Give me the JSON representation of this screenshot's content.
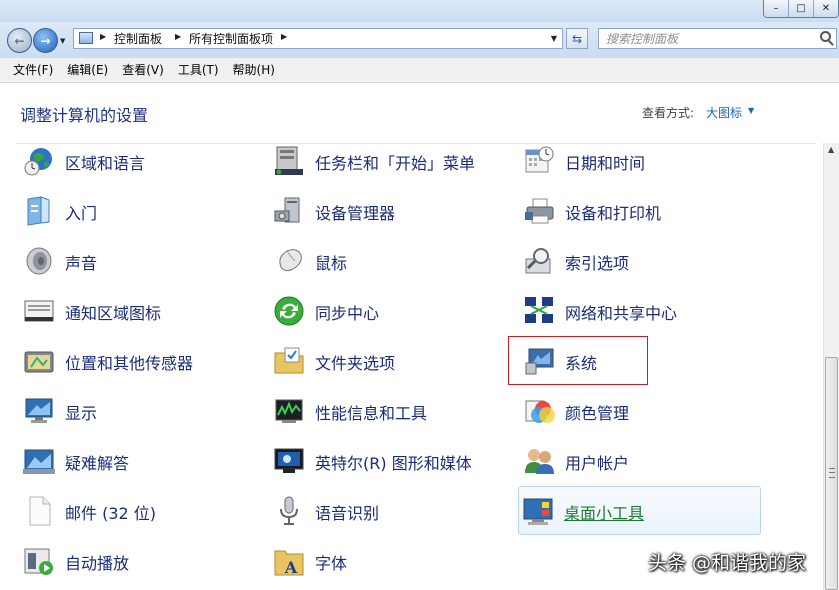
{
  "window": {
    "controls": {
      "minimize": "–",
      "maximize": "□",
      "close": "✕"
    }
  },
  "navigation": {
    "breadcrumb": [
      "控制面板",
      "所有控制面板项"
    ],
    "search_placeholder": "搜索控制面板",
    "icons": [
      "back-icon",
      "forward-icon",
      "refresh-icon",
      "search-icon"
    ]
  },
  "menubar": [
    "文件(F)",
    "编辑(E)",
    "查看(V)",
    "工具(T)",
    "帮助(H)"
  ],
  "header": {
    "title": "调整计算机的设置",
    "view_label": "查看方式:",
    "view_value": "大图标"
  },
  "items": [
    {
      "label": "区域和语言",
      "icon": "globe-clock-icon"
    },
    {
      "label": "任务栏和「开始」菜单",
      "icon": "taskbar-icon"
    },
    {
      "label": "日期和时间",
      "icon": "calendar-clock-icon"
    },
    {
      "label": "入门",
      "icon": "getting-started-icon"
    },
    {
      "label": "设备管理器",
      "icon": "device-manager-icon"
    },
    {
      "label": "设备和打印机",
      "icon": "printer-icon"
    },
    {
      "label": "声音",
      "icon": "speaker-icon"
    },
    {
      "label": "鼠标",
      "icon": "mouse-icon"
    },
    {
      "label": "索引选项",
      "icon": "indexing-icon"
    },
    {
      "label": "通知区域图标",
      "icon": "notification-icon"
    },
    {
      "label": "同步中心",
      "icon": "sync-icon"
    },
    {
      "label": "网络和共享中心",
      "icon": "network-icon"
    },
    {
      "label": "位置和其他传感器",
      "icon": "location-sensor-icon"
    },
    {
      "label": "文件夹选项",
      "icon": "folder-options-icon"
    },
    {
      "label": "系统",
      "icon": "system-monitor-icon"
    },
    {
      "label": "显示",
      "icon": "display-icon"
    },
    {
      "label": "性能信息和工具",
      "icon": "performance-icon"
    },
    {
      "label": "颜色管理",
      "icon": "color-management-icon"
    },
    {
      "label": "疑难解答",
      "icon": "troubleshoot-icon"
    },
    {
      "label": "英特尔(R) 图形和媒体",
      "icon": "intel-graphics-icon"
    },
    {
      "label": "用户帐户",
      "icon": "user-accounts-icon"
    },
    {
      "label": "邮件 (32 位)",
      "icon": "mail-icon"
    },
    {
      "label": "语音识别",
      "icon": "microphone-icon"
    },
    {
      "label": "桌面小工具",
      "icon": "desktop-gadgets-icon"
    },
    {
      "label": "自动播放",
      "icon": "autoplay-icon"
    },
    {
      "label": "字体",
      "icon": "fonts-icon"
    }
  ],
  "watermark": "头条 @和谐我的家"
}
